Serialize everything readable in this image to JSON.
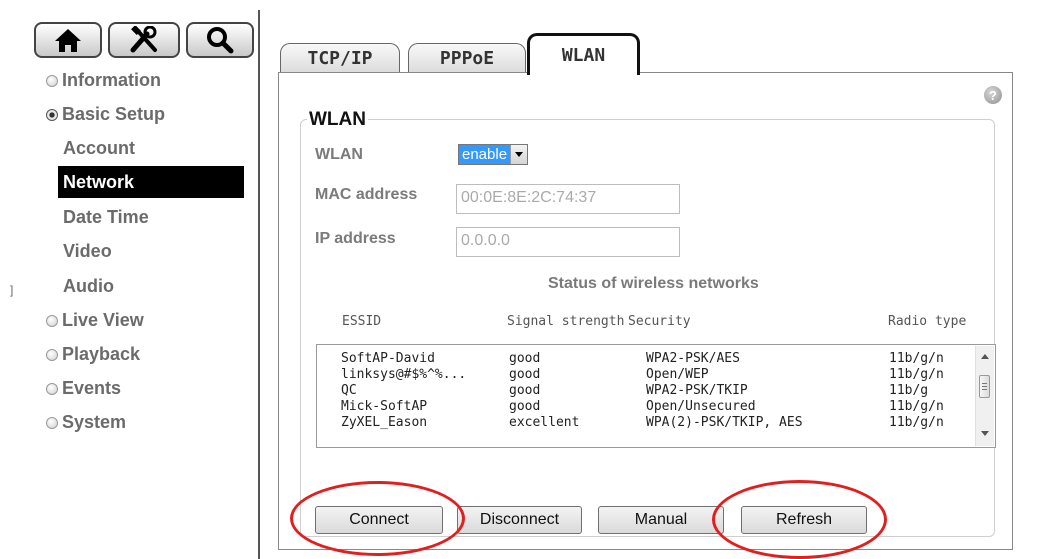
{
  "toolbar": {
    "home_icon": "home-icon",
    "settings_icon": "tools-icon",
    "search_icon": "search-icon"
  },
  "sidebar": {
    "sections": [
      {
        "label": "Information",
        "expanded": false
      },
      {
        "label": "Basic Setup",
        "expanded": true
      },
      {
        "label": "Live View",
        "expanded": false
      },
      {
        "label": "Playback",
        "expanded": false
      },
      {
        "label": "Events",
        "expanded": false
      },
      {
        "label": "System",
        "expanded": false
      }
    ],
    "basic_setup_items": [
      "Account",
      "Network",
      "Date Time",
      "Video",
      "Audio"
    ],
    "active_item": "Network"
  },
  "edge_mark": "]",
  "tabs": [
    {
      "label": "TCP/IP",
      "active": false
    },
    {
      "label": "PPPoE",
      "active": false
    },
    {
      "label": "WLAN",
      "active": true
    }
  ],
  "wlan": {
    "legend": "WLAN",
    "help_icon": "?",
    "wlan_label": "WLAN",
    "wlan_value": "enable",
    "mac_label": "MAC address",
    "mac_value": "00:0E:8E:2C:74:37",
    "ip_label": "IP address",
    "ip_value": "0.0.0.0",
    "status_title": "Status of wireless networks",
    "columns": {
      "essid": "ESSID",
      "signal": "Signal strength",
      "security": "Security",
      "radio": "Radio type"
    },
    "networks": [
      {
        "essid": "SoftAP-David",
        "signal": "good",
        "security": "WPA2-PSK/AES",
        "radio": "11b/g/n"
      },
      {
        "essid": "linksys@#$%^%...",
        "signal": "good",
        "security": "Open/WEP",
        "radio": "11b/g/n"
      },
      {
        "essid": "QC",
        "signal": "good",
        "security": "WPA2-PSK/TKIP",
        "radio": "11b/g"
      },
      {
        "essid": "Mick-SoftAP",
        "signal": "good",
        "security": "Open/Unsecured",
        "radio": "11b/g/n"
      },
      {
        "essid": "ZyXEL_Eason",
        "signal": "excellent",
        "security": "WPA(2)-PSK/TKIP, AES",
        "radio": "11b/g/n"
      }
    ],
    "buttons": {
      "connect": "Connect",
      "disconnect": "Disconnect",
      "manual": "Manual",
      "refresh": "Refresh"
    }
  },
  "annotation_color": "#e02020"
}
